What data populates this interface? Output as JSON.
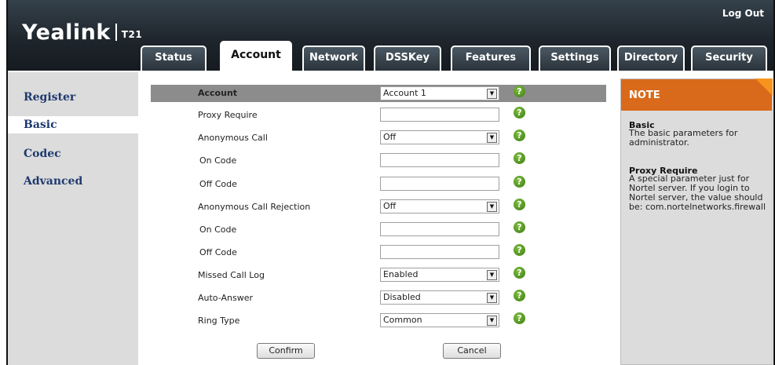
{
  "header": {
    "logo_text": "Yealink",
    "model": "T21",
    "logout": "Log Out"
  },
  "tabs": [
    {
      "label": "Status",
      "active": false
    },
    {
      "label": "Account",
      "active": true
    },
    {
      "label": "Network",
      "active": false
    },
    {
      "label": "DSSKey",
      "active": false
    },
    {
      "label": "Features",
      "active": false
    },
    {
      "label": "Settings",
      "active": false
    },
    {
      "label": "Directory",
      "active": false
    },
    {
      "label": "Security",
      "active": false
    }
  ],
  "sidebar": {
    "items": [
      {
        "label": "Register",
        "active": false
      },
      {
        "label": "Basic",
        "active": true
      },
      {
        "label": "Codec",
        "active": false
      },
      {
        "label": "Advanced",
        "active": false
      }
    ]
  },
  "form": {
    "account_label": "Account",
    "account_value": "Account 1",
    "rows": [
      {
        "label": "Proxy Require",
        "type": "text",
        "value": ""
      },
      {
        "label": "Anonymous Call",
        "type": "select",
        "value": "Off"
      },
      {
        "label": "On Code",
        "type": "text",
        "value": ""
      },
      {
        "label": "Off Code",
        "type": "text",
        "value": ""
      },
      {
        "label": "Anonymous Call Rejection",
        "type": "select",
        "value": "Off"
      },
      {
        "label": "On Code",
        "type": "text",
        "value": ""
      },
      {
        "label": "Off Code",
        "type": "text",
        "value": ""
      },
      {
        "label": "Missed Call Log",
        "type": "select",
        "value": "Enabled"
      },
      {
        "label": "Auto-Answer",
        "type": "select",
        "value": "Disabled"
      },
      {
        "label": "Ring Type",
        "type": "select",
        "value": "Common"
      }
    ],
    "help_symbol": "?",
    "confirm": "Confirm",
    "cancel": "Cancel"
  },
  "note": {
    "title": "NOTE",
    "sections": [
      {
        "heading": "Basic",
        "text": "The basic parameters for administrator."
      },
      {
        "heading": "Proxy Require",
        "text": "A special parameter just for Nortel server. If you login to Nortel server, the value should be: com.nortelnetworks.firewall"
      }
    ]
  },
  "colors": {
    "header_dark": "#1d242b",
    "sidebar_gray": "#dcdcdc",
    "account_bar": "#8c8c8c",
    "note_orange": "#d96a1b",
    "nav_link": "#1f3a6e",
    "help_green": "#4a9a1a"
  },
  "icons": {
    "help": "question-circle-icon",
    "dropdown": "dropdown-arrow-icon"
  }
}
